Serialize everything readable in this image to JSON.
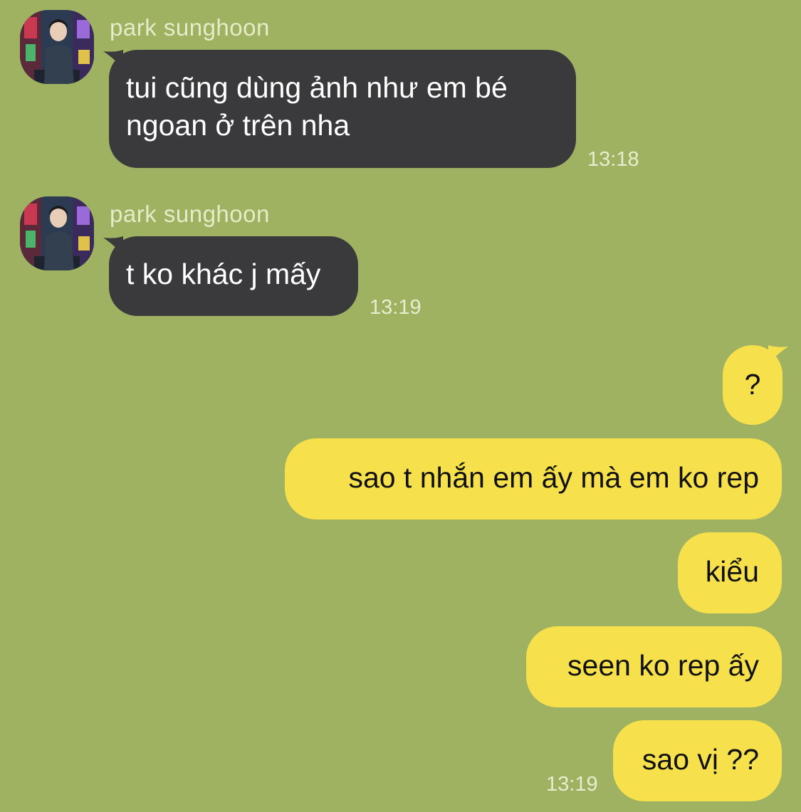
{
  "colors": {
    "background": "#9fb262",
    "incoming_bubble": "#3a3a3c",
    "outgoing_bubble": "#f6e04b",
    "meta_text": "#e4ecc8"
  },
  "incoming": [
    {
      "sender": "park sunghoon",
      "avatar_icon": "profile-photo-icon",
      "lines": [
        "tui cũng dùng ảnh như em bé",
        "ngoan ở trên nha"
      ],
      "time": "13:18"
    },
    {
      "sender": "park sunghoon",
      "avatar_icon": "profile-photo-icon",
      "lines": [
        "t ko khác j mấy"
      ],
      "time": "13:19"
    }
  ],
  "outgoing": [
    {
      "text": "?"
    },
    {
      "text": "sao t nhắn em ấy mà em ko rep"
    },
    {
      "text": "kiểu"
    },
    {
      "text": "seen ko rep ấy"
    },
    {
      "text": "sao vị ??"
    }
  ],
  "outgoing_time": "13:19"
}
